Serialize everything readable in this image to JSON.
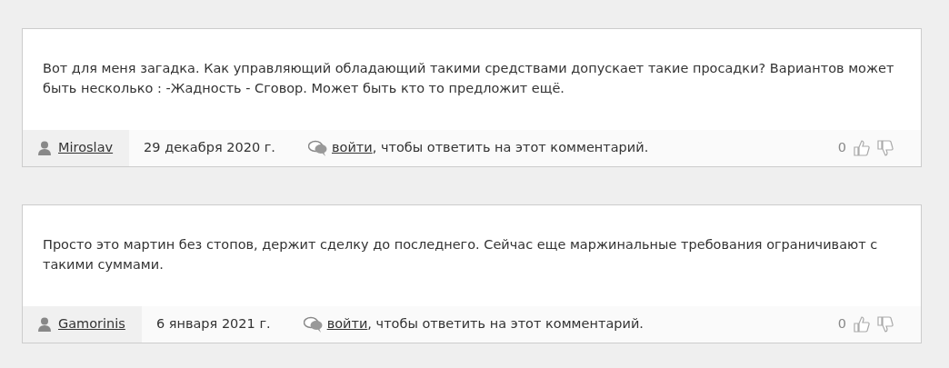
{
  "comments": [
    {
      "text": "Вот для меня загадка. Как управляющий обладающий такими средствами допускает такие просадки? Вариантов может быть несколько : -Жадность - Сговор. Может быть кто то предложит ещё.",
      "author": "Miroslav",
      "date": "29 декабря 2020 г.",
      "login_link": "войти",
      "login_rest": ", чтобы ответить на этот комментарий.",
      "score": "0"
    },
    {
      "text": "Просто это мартин без стопов, держит сделку до последнего. Сейчас еще маржинальные требования ограничивают с такими суммами.",
      "author": "Gamorinis",
      "date": "6 января 2021 г.",
      "login_link": "войти",
      "login_rest": ", чтобы ответить на этот комментарий.",
      "score": "0"
    }
  ]
}
